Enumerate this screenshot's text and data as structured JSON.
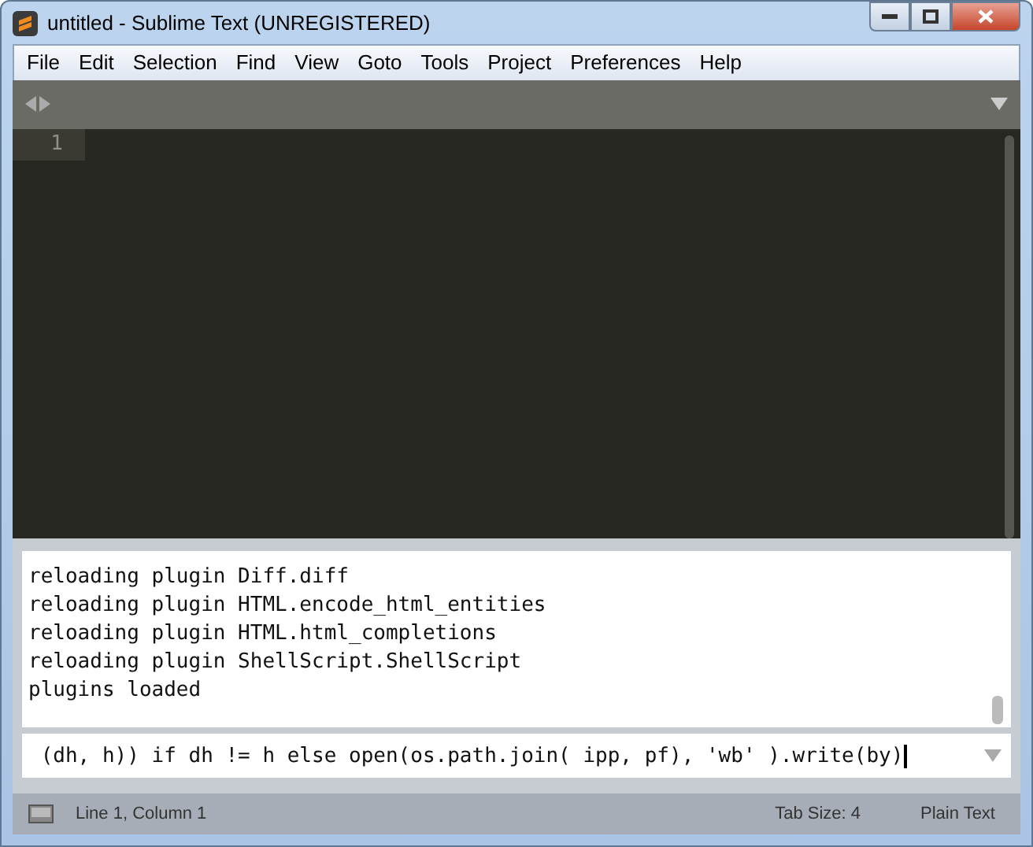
{
  "window": {
    "title": "untitled - Sublime Text (UNREGISTERED)"
  },
  "menu": [
    "File",
    "Edit",
    "Selection",
    "Find",
    "View",
    "Goto",
    "Tools",
    "Project",
    "Preferences",
    "Help"
  ],
  "editor": {
    "line_numbers": [
      "1"
    ]
  },
  "console": {
    "lines": [
      "reloading plugin Diff.diff",
      "reloading plugin HTML.encode_html_entities",
      "reloading plugin HTML.html_completions",
      "reloading plugin ShellScript.ShellScript",
      "plugins loaded"
    ]
  },
  "input": {
    "value": " (dh, h)) if dh != h else open(os.path.join( ipp, pf), 'wb' ).write(by)"
  },
  "status_bar": {
    "position": "Line 1, Column 1",
    "tab_size": "Tab Size: 4",
    "syntax": "Plain Text"
  }
}
